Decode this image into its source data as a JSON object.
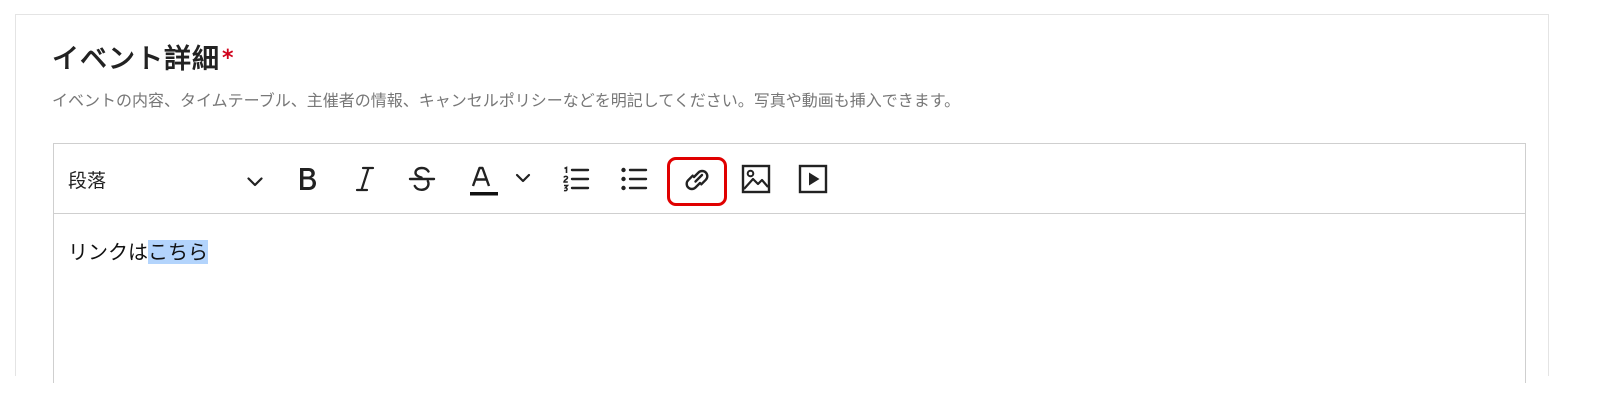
{
  "form": {
    "title": "イベント詳細",
    "required_mark": "*",
    "description": "イベントの内容、タイムテーブル、主催者の情報、キャンセルポリシーなどを明記してください。写真や動画も挿入できます。"
  },
  "toolbar": {
    "paragraph_style": "段落",
    "buttons": [
      {
        "icon": "bold-icon"
      },
      {
        "icon": "italic-icon"
      },
      {
        "icon": "strikethrough-icon"
      },
      {
        "icon": "text-color-icon",
        "color": "#111111"
      },
      {
        "icon": "ordered-list-icon"
      },
      {
        "icon": "bullet-list-icon"
      },
      {
        "icon": "link-icon",
        "highlight_color": "#e00000"
      },
      {
        "icon": "image-icon"
      },
      {
        "icon": "video-icon"
      }
    ]
  },
  "editor": {
    "text_before": "リンクは",
    "text_selected": "こちら",
    "selection_color": "#b3d4fc"
  }
}
